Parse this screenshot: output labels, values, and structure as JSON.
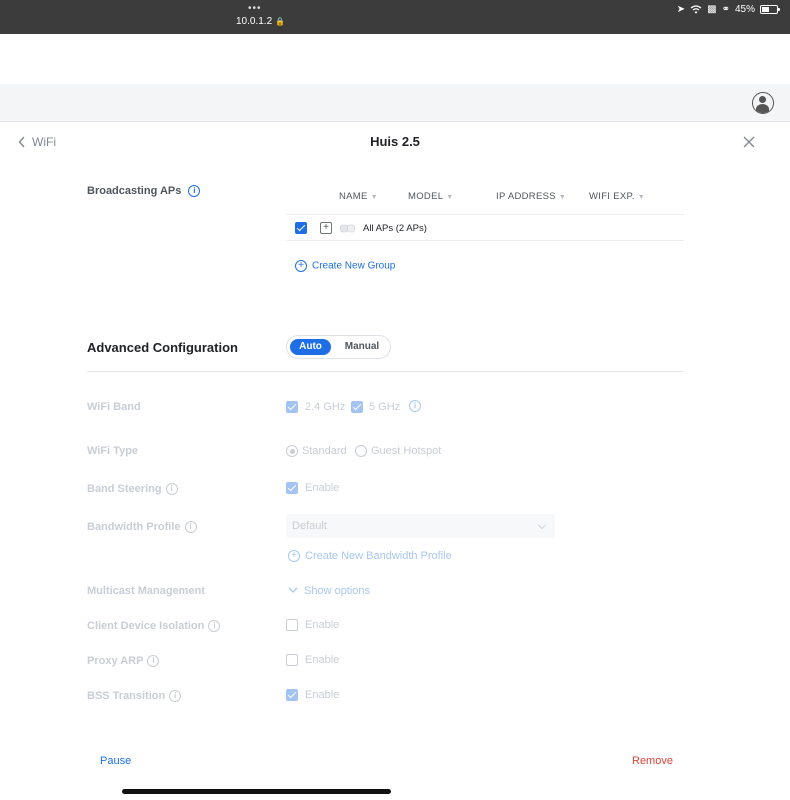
{
  "status_bar": {
    "dots": "•••",
    "url": "10.0.1.2",
    "battery": "45%"
  },
  "header": {
    "back_label": "WiFi",
    "title": "Huis 2.5"
  },
  "broadcasting": {
    "label": "Broadcasting APs",
    "columns": [
      "NAME",
      "MODEL",
      "IP ADDRESS",
      "WIFI EXP."
    ],
    "row_label": "All APs (2 APs)",
    "create_group": "Create New Group"
  },
  "advanced": {
    "title": "Advanced Configuration",
    "mode_auto": "Auto",
    "mode_manual": "Manual",
    "selected_mode": "Auto"
  },
  "fields": {
    "wifi_band": {
      "label": "WiFi Band",
      "opt1": "2.4 GHz",
      "opt2": "5 GHz"
    },
    "wifi_type": {
      "label": "WiFi Type",
      "opt1": "Standard",
      "opt2": "Guest Hotspot"
    },
    "band_steering": {
      "label": "Band Steering",
      "value": "Enable"
    },
    "bandwidth_profile": {
      "label": "Bandwidth Profile",
      "value": "Default",
      "create": "Create New Bandwidth Profile"
    },
    "multicast": {
      "label": "Multicast Management",
      "value": "Show options"
    },
    "client_isolation": {
      "label": "Client Device Isolation",
      "value": "Enable"
    },
    "proxy_arp": {
      "label": "Proxy ARP",
      "value": "Enable"
    },
    "bss_transition": {
      "label": "BSS Transition",
      "value": "Enable"
    }
  },
  "footer": {
    "pause": "Pause",
    "remove": "Remove"
  },
  "colors": {
    "accent": "#1e6fe6",
    "danger": "#d9453c",
    "disabled": "#c9ced5"
  }
}
